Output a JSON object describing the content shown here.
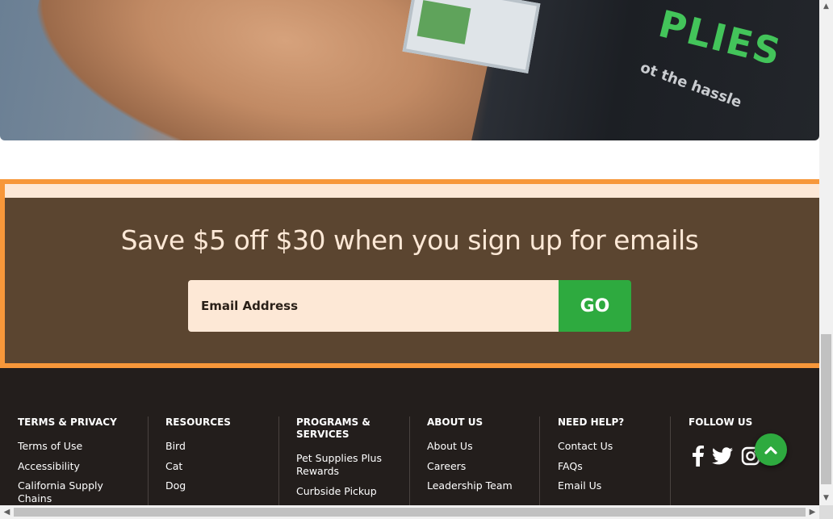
{
  "signup": {
    "title": "Save $5 off $30 when you sign up for emails",
    "email_placeholder": "Email Address",
    "go_label": "GO"
  },
  "footer": {
    "columns": [
      {
        "heading": "TERMS & PRIVACY",
        "links": [
          "Terms of Use",
          "Accessibility",
          "California Supply Chains"
        ]
      },
      {
        "heading": "RESOURCES",
        "links": [
          "Bird",
          "Cat",
          "Dog"
        ]
      },
      {
        "heading": "PROGRAMS & SERVICES",
        "links": [
          "Pet Supplies Plus Rewards",
          "Curbside Pickup"
        ]
      },
      {
        "heading": "ABOUT US",
        "links": [
          "About Us",
          "Careers",
          "Leadership Team"
        ]
      },
      {
        "heading": "NEED HELP?",
        "links": [
          "Contact Us",
          "FAQs",
          "Email Us"
        ]
      },
      {
        "heading": "FOLLOW US",
        "social": [
          "facebook-icon",
          "twitter-icon",
          "instagram-icon"
        ]
      }
    ]
  },
  "hero": {
    "shirt_text": "PLIES",
    "shirt_sub": "ot the hassle"
  },
  "colors": {
    "orange_border": "#f7973a",
    "brown_band": "#5b4530",
    "cream": "#fde8d6",
    "green": "#2eaa3f",
    "footer_bg": "#231e1c"
  }
}
